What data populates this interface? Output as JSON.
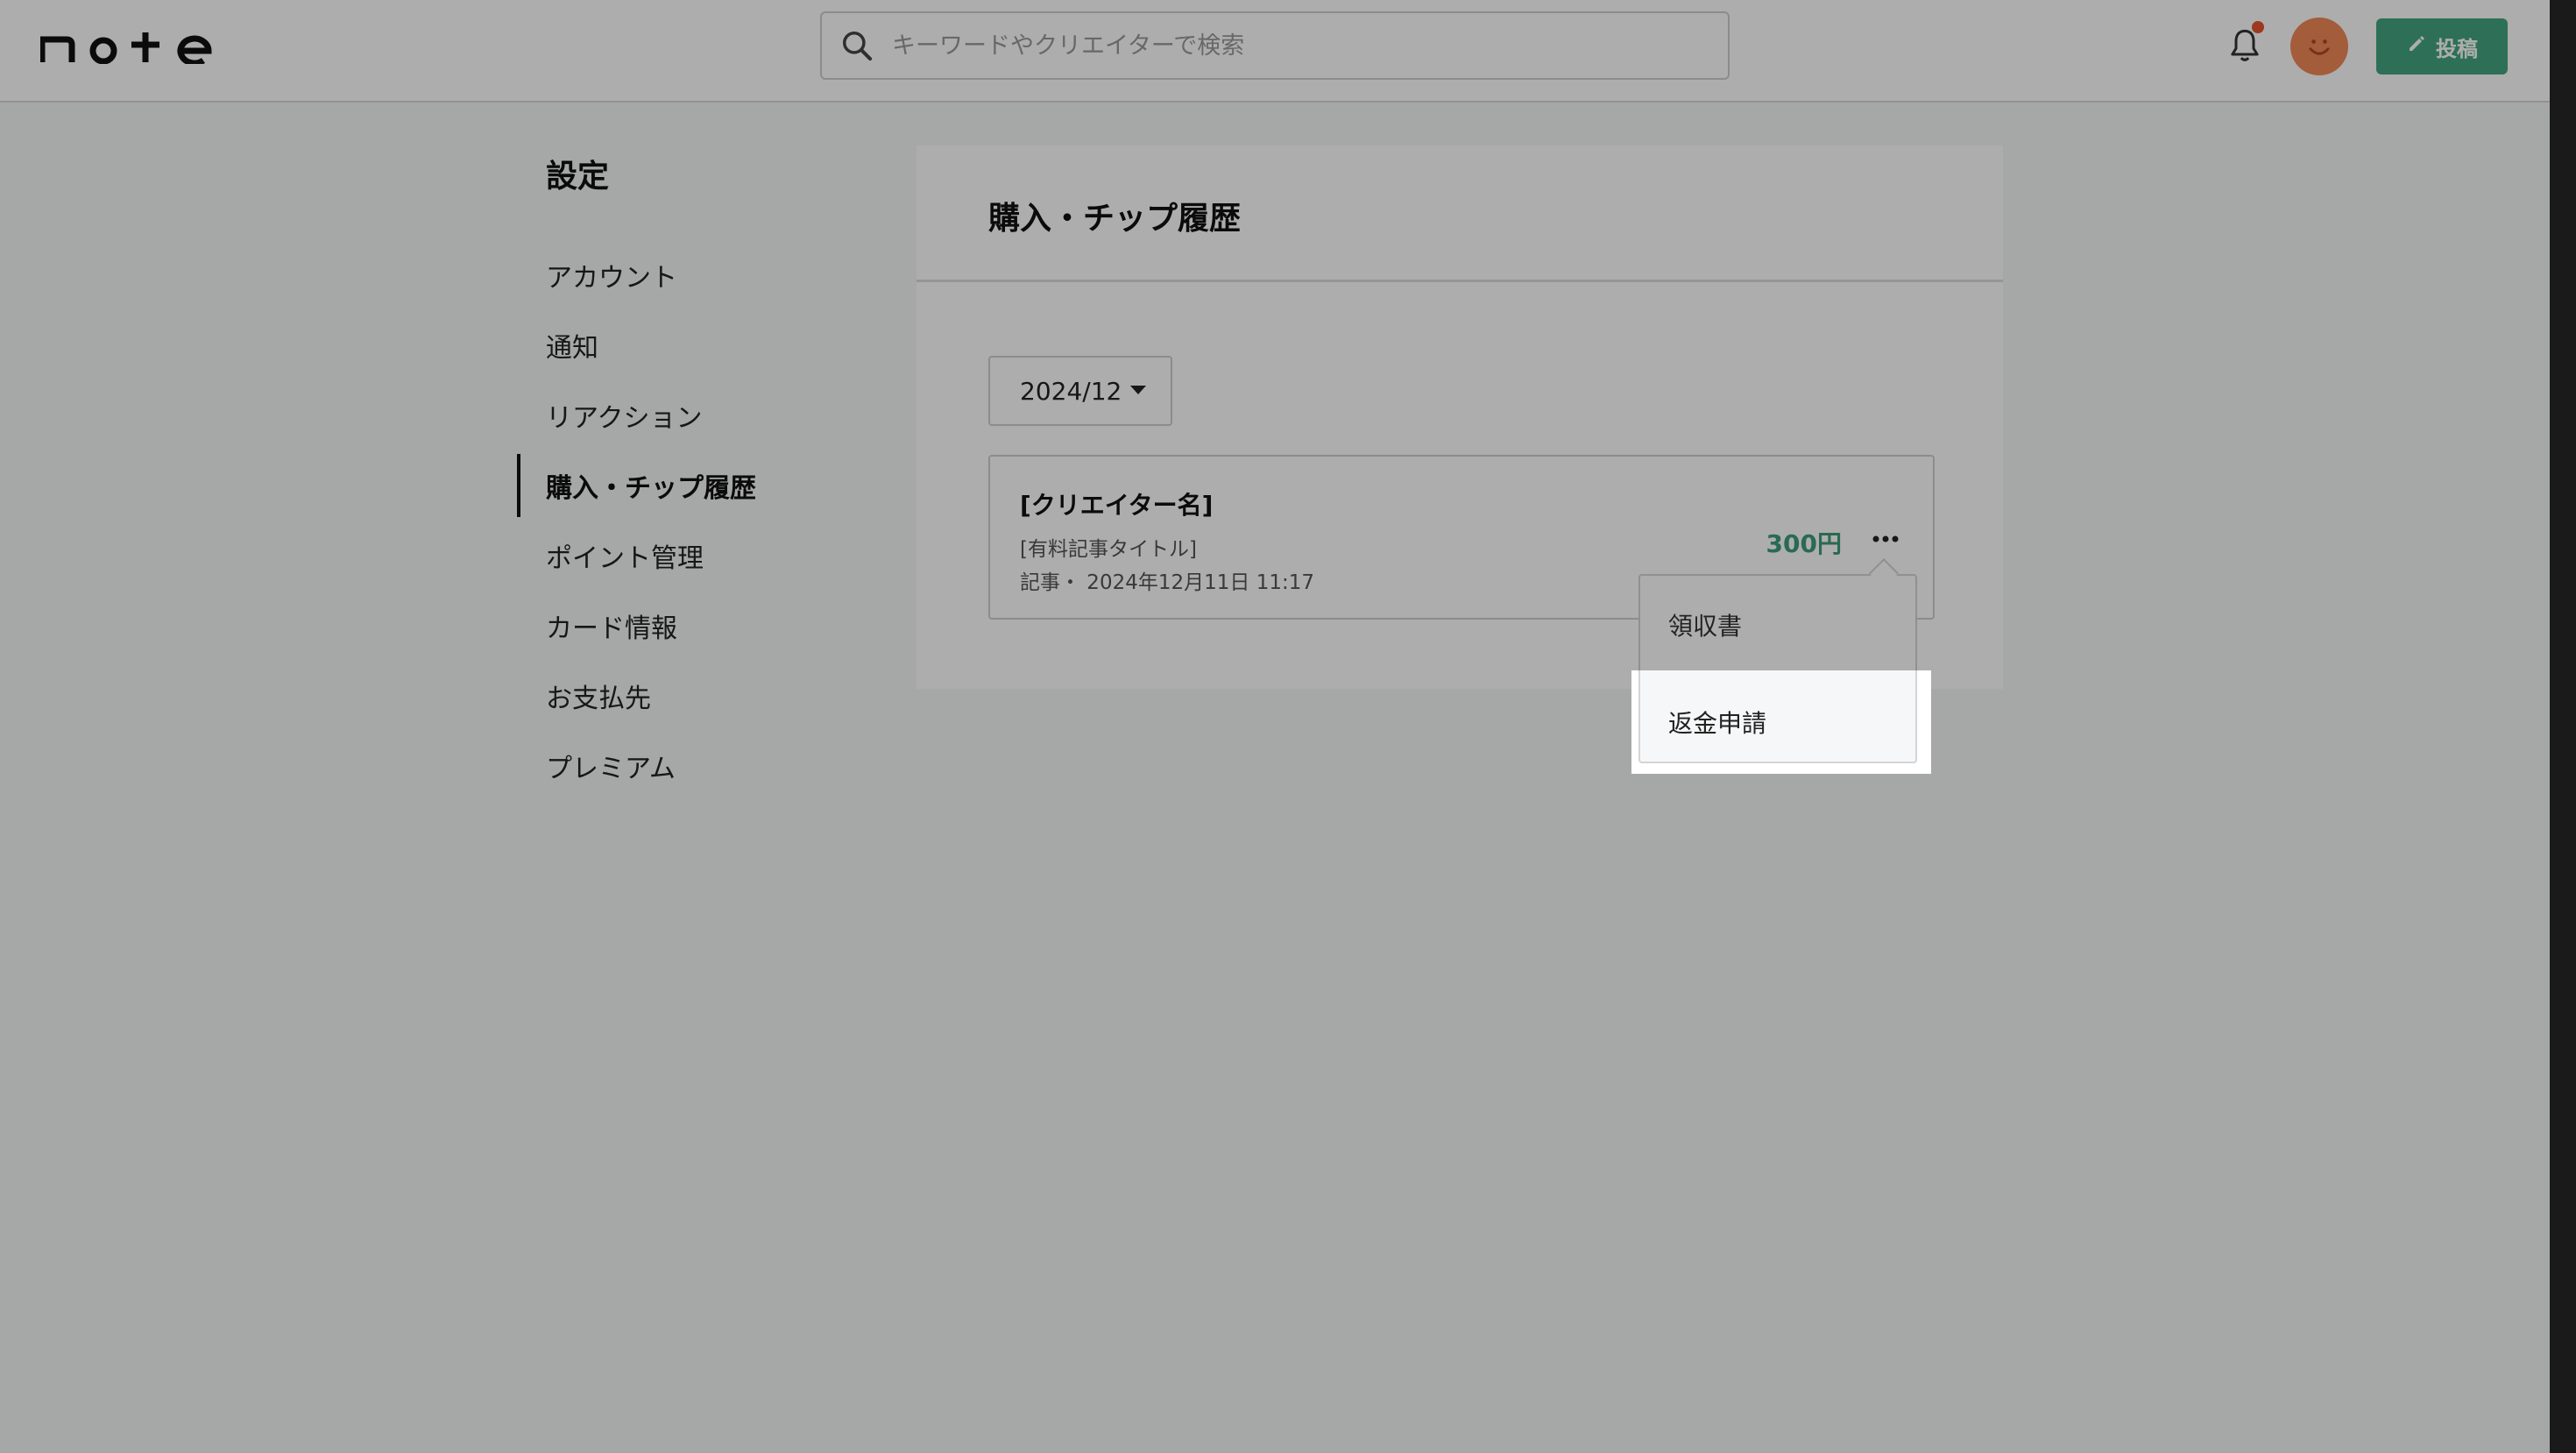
{
  "header": {
    "logo_text": "note",
    "search_placeholder": "キーワードやクリエイターで検索",
    "post_button_label": "投稿",
    "icons": {
      "search": "search-icon",
      "notification": "bell-icon",
      "avatar": "smiley-avatar",
      "post": "pencil-icon"
    },
    "colors": {
      "post_button": "#43a681",
      "notification_dot": "#e8542f",
      "avatar": "#f08a56"
    }
  },
  "sidebar": {
    "title": "設定",
    "items": [
      {
        "label": "アカウント",
        "active": false
      },
      {
        "label": "通知",
        "active": false
      },
      {
        "label": "リアクション",
        "active": false
      },
      {
        "label": "購入・チップ履歴",
        "active": true
      },
      {
        "label": "ポイント管理",
        "active": false
      },
      {
        "label": "カード情報",
        "active": false
      },
      {
        "label": "お支払先",
        "active": false
      },
      {
        "label": "プレミアム",
        "active": false
      }
    ]
  },
  "main": {
    "title": "購入・チップ履歴",
    "month_selected": "2024/12",
    "purchases": [
      {
        "creator": "[クリエイター名]",
        "article_title": "[有料記事タイトル]",
        "meta": "記事・ 2024年12月11日 11:17",
        "price": "300円",
        "price_color": "#3d9c79"
      }
    ]
  },
  "dropdown": {
    "items": [
      {
        "label": "領収書"
      },
      {
        "label": "返金申請",
        "highlighted": true
      }
    ]
  }
}
